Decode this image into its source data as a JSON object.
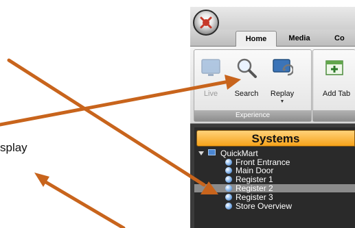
{
  "annotation": {
    "text": "splay"
  },
  "app": {
    "tabs": {
      "home": "Home",
      "media": "Media",
      "next": "Co"
    },
    "ribbon": {
      "experience_group": "Experience",
      "buttons": {
        "live": "Live",
        "search": "Search",
        "replay": "Replay",
        "add_tab": "Add Tab"
      }
    },
    "systems": {
      "header": "Systems",
      "root": "QuickMart",
      "cameras": [
        "Front Entrance",
        "Main Door",
        "Register 1",
        "Register 2",
        "Register 3",
        "Store Overview"
      ],
      "selected": "Register 2"
    }
  },
  "colors": {
    "arrow": "#c8641c",
    "systems_header": "#f6a21a",
    "panel_bg": "#2a2a2a",
    "selected_row": "#8b8b8b"
  }
}
